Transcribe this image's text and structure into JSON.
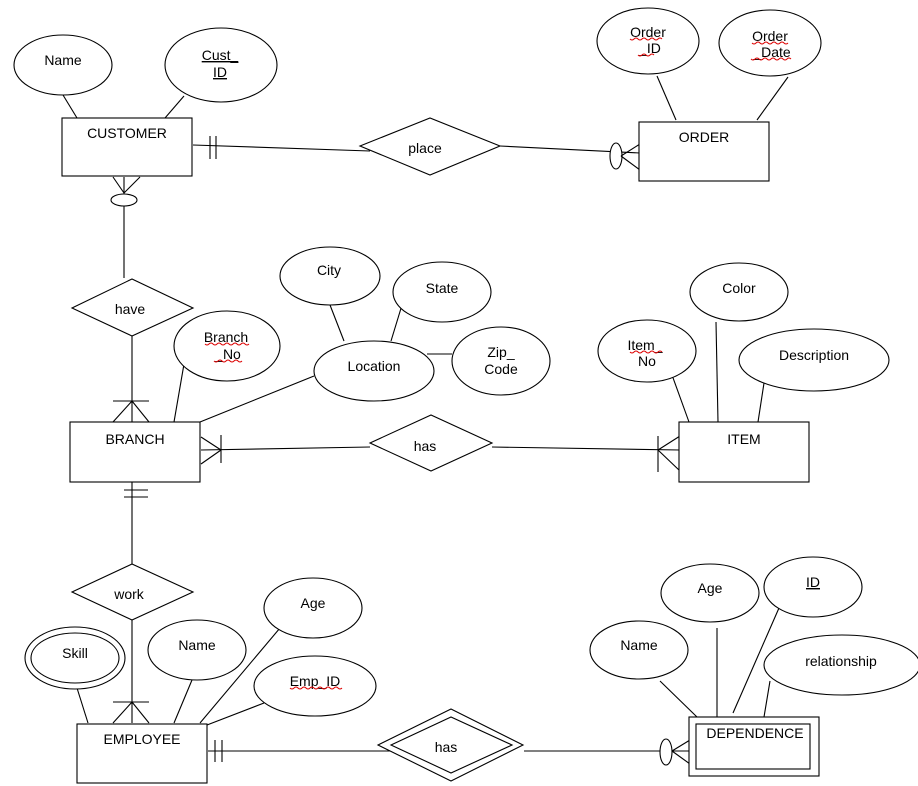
{
  "diagram": {
    "type": "ER diagram",
    "entities": {
      "customer": "CUSTOMER",
      "order": "ORDER",
      "branch": "BRANCH",
      "item": "ITEM",
      "employee": "EMPLOYEE",
      "dependence": "DEPENDENCE"
    },
    "relationships": {
      "place": "place",
      "have": "have",
      "has_branch_item": "has",
      "work": "work",
      "has_employee_dependence": "has"
    },
    "attributes": {
      "customer_name": "Name",
      "cust_id_line1": "Cust_",
      "cust_id_line2": "ID",
      "order_id_line1": "Order",
      "order_id_line2": "_ID",
      "order_date_line1": "Order",
      "order_date_line2": "_Date",
      "city": "City",
      "state": "State",
      "location": "Location",
      "zip_line1": "Zip_",
      "zip_line2": "Code",
      "branch_no_line1": "Branch",
      "branch_no_line2": "_No",
      "color": "Color",
      "item_no_line1": "Item_",
      "item_no_line2": "No",
      "description": "Description",
      "skill": "Skill",
      "employee_name": "Name",
      "employee_age": "Age",
      "emp_id": "Emp_ID",
      "dependence_age": "Age",
      "dependence_id": "ID",
      "dependence_name": "Name",
      "relationship": "relationship"
    }
  }
}
